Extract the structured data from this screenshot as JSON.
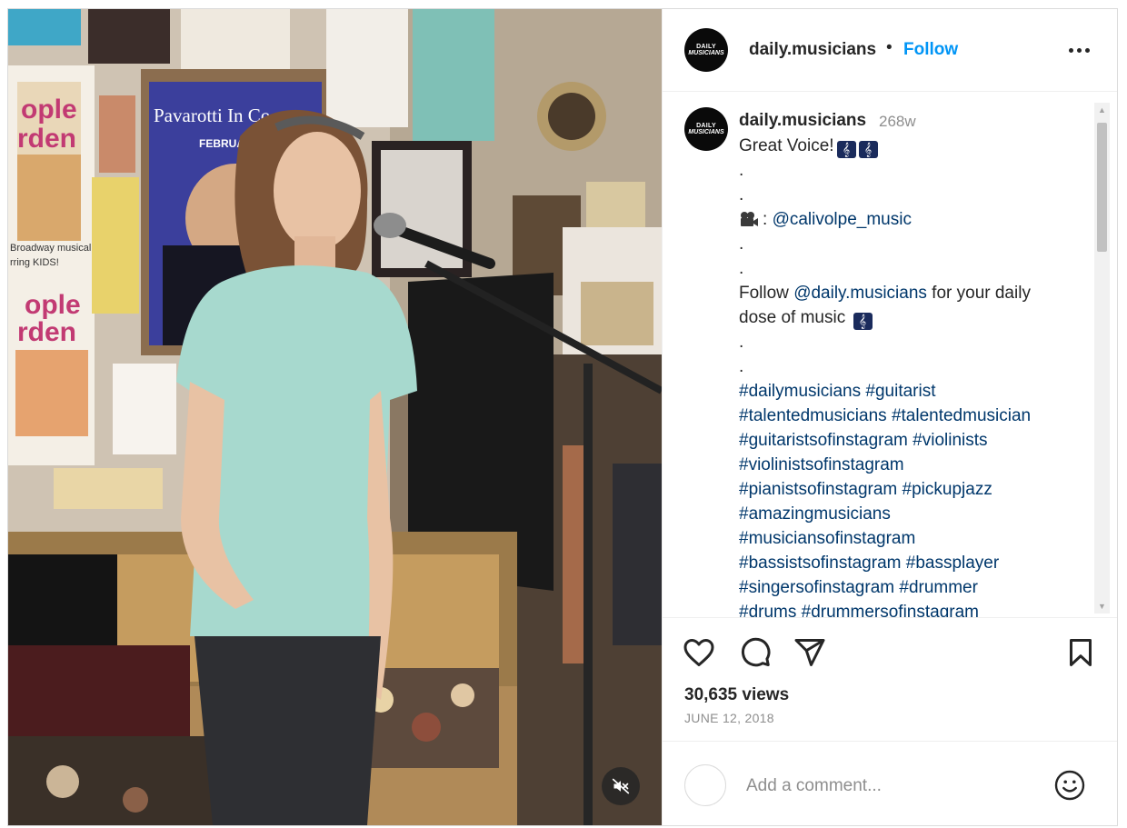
{
  "post": {
    "username": "daily.musicians",
    "follow_label": "Follow",
    "separator": "•",
    "avatar_text_line1": "DAILY",
    "avatar_text_line2": "MUSICIANS"
  },
  "caption": {
    "username": "daily.musicians",
    "time_ago": "268w",
    "lines": {
      "l1": "Great Voice!",
      "dot1": ".",
      "dot2": ".",
      "credit_prefix": ":",
      "credit_handle": "@calivolpe_music",
      "dot3": ".",
      "dot4": ".",
      "follow_prefix": "Follow",
      "follow_handle": "@daily.musicians",
      "follow_suffix_a": "for your daily",
      "follow_suffix_b": "dose of music",
      "dot5": ".",
      "dot6": "."
    },
    "hashtags": [
      [
        "#dailymusicians",
        "#guitarist"
      ],
      [
        "#talentedmusicians",
        "#talentedmusician"
      ],
      [
        "#guitaristsofinstagram",
        "#violinists"
      ],
      [
        "#violinistsofinstagram"
      ],
      [
        "#pianistsofinstagram",
        "#pickupjazz"
      ],
      [
        "#amazingmusicians"
      ],
      [
        "#musiciansofinstagram"
      ],
      [
        "#bassistsofinstagram",
        "#bassplayer"
      ],
      [
        "#singersofinstagram",
        "#drummer"
      ],
      [
        "#drums",
        "#drummersofinstagram"
      ]
    ]
  },
  "stats": {
    "views": "30,635 views",
    "date": "JUNE 12, 2018"
  },
  "comment": {
    "placeholder": "Add a comment..."
  },
  "media": {
    "poster_text": "Pavarotti In Co",
    "poster_sub": "FEBRUARY",
    "poster_left_a": "ople",
    "poster_left_b": "rden",
    "poster_left_c": "ople",
    "poster_left_d": "rden",
    "poster_left_e": "Broadway musical",
    "poster_left_f": "rring KIDS!"
  },
  "icons": {
    "like": "heart-icon",
    "comment": "comment-icon",
    "share": "paper-plane-icon",
    "save": "bookmark-icon",
    "mute": "speaker-muted-icon",
    "more": "more-options-icon",
    "emoji": "smiley-icon"
  },
  "colors": {
    "link": "#00376b",
    "follow": "#0095f6",
    "muted_text": "#8e8e8e"
  }
}
